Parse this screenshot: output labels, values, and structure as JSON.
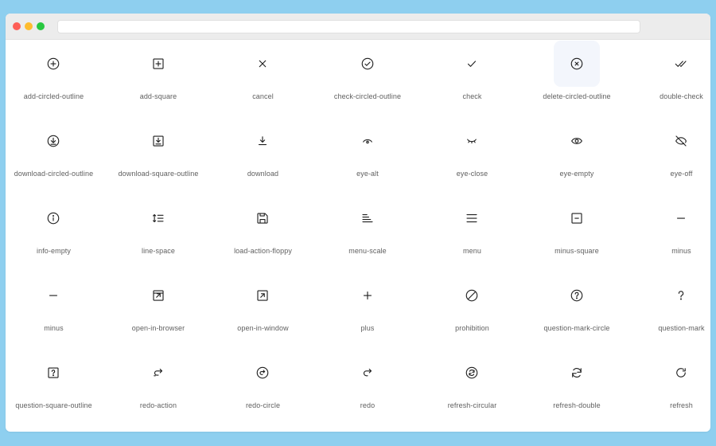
{
  "browser": {
    "url": ""
  },
  "highlight_index": 5,
  "icons": [
    {
      "label": "add-circled-outline",
      "icon": "add-circled-outline-icon"
    },
    {
      "label": "add-square",
      "icon": "add-square-icon"
    },
    {
      "label": "cancel",
      "icon": "cancel-icon"
    },
    {
      "label": "check-circled-outline",
      "icon": "check-circled-outline-icon"
    },
    {
      "label": "check",
      "icon": "check-icon"
    },
    {
      "label": "delete-circled-outline",
      "icon": "delete-circled-outline-icon"
    },
    {
      "label": "double-check",
      "icon": "double-check-icon"
    },
    {
      "label": "download-circled-outline",
      "icon": "download-circled-outline-icon"
    },
    {
      "label": "download-square-outline",
      "icon": "download-square-outline-icon"
    },
    {
      "label": "download",
      "icon": "download-icon"
    },
    {
      "label": "eye-alt",
      "icon": "eye-alt-icon"
    },
    {
      "label": "eye-close",
      "icon": "eye-close-icon"
    },
    {
      "label": "eye-empty",
      "icon": "eye-empty-icon"
    },
    {
      "label": "eye-off",
      "icon": "eye-off-icon"
    },
    {
      "label": "info-empty",
      "icon": "info-empty-icon"
    },
    {
      "label": "line-space",
      "icon": "line-space-icon"
    },
    {
      "label": "load-action-floppy",
      "icon": "load-action-floppy-icon"
    },
    {
      "label": "menu-scale",
      "icon": "menu-scale-icon"
    },
    {
      "label": "menu",
      "icon": "menu-icon"
    },
    {
      "label": "minus-square",
      "icon": "minus-square-icon"
    },
    {
      "label": "minus",
      "icon": "minus-icon"
    },
    {
      "label": "minus",
      "icon": "minus-icon"
    },
    {
      "label": "open-in-browser",
      "icon": "open-in-browser-icon"
    },
    {
      "label": "open-in-window",
      "icon": "open-in-window-icon"
    },
    {
      "label": "plus",
      "icon": "plus-icon"
    },
    {
      "label": "prohibition",
      "icon": "prohibition-icon"
    },
    {
      "label": "question-mark-circle",
      "icon": "question-mark-circle-icon"
    },
    {
      "label": "question-mark",
      "icon": "question-mark-icon"
    },
    {
      "label": "question-square-outline",
      "icon": "question-square-outline-icon"
    },
    {
      "label": "redo-action",
      "icon": "redo-action-icon"
    },
    {
      "label": "redo-circle",
      "icon": "redo-circle-icon"
    },
    {
      "label": "redo",
      "icon": "redo-icon"
    },
    {
      "label": "refresh-circular",
      "icon": "refresh-circular-icon"
    },
    {
      "label": "refresh-double",
      "icon": "refresh-double-icon"
    },
    {
      "label": "refresh",
      "icon": "refresh-icon"
    }
  ]
}
